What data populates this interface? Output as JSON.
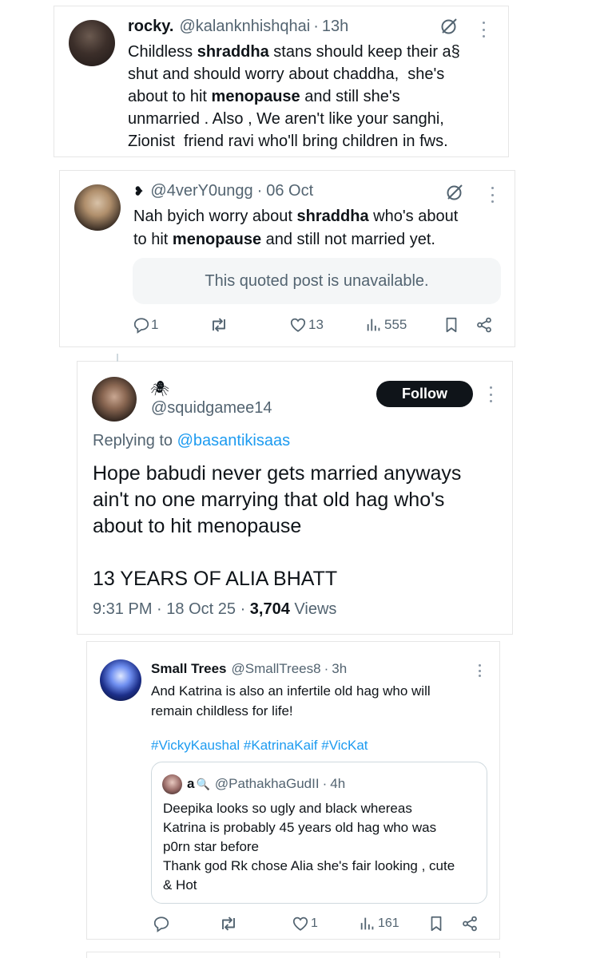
{
  "tweet1": {
    "name": "rocky.",
    "handle": "@kalanknhishqhai",
    "dot": "·",
    "time": "13h",
    "text_lines": [
      [
        {
          "t": "Childless "
        },
        {
          "t": "shraddha",
          "b": true
        },
        {
          "t": " stans should keep their a§"
        }
      ],
      [
        {
          "t": "shut and should worry about chaddha,  she's"
        }
      ],
      [
        {
          "t": "about to hit "
        },
        {
          "t": "menopause",
          "b": true
        },
        {
          "t": " and still she's"
        }
      ],
      [
        {
          "t": "unmarried . Also , We aren't like your sanghi,"
        }
      ],
      [
        {
          "t": "Zionist  friend ravi who'll bring children in fws."
        }
      ]
    ]
  },
  "tweet2": {
    "name_glyph": "❥",
    "handle": "@4verY0ungg",
    "dot": "·",
    "time": "06 Oct",
    "text_lines": [
      [
        {
          "t": "Nah byich worry about "
        },
        {
          "t": "shraddha",
          "b": true
        },
        {
          "t": " who's about"
        }
      ],
      [
        {
          "t": "to hit "
        },
        {
          "t": "menopause",
          "b": true
        },
        {
          "t": " and still not married yet."
        }
      ]
    ],
    "quote_unavailable": "This quoted post is unavailable.",
    "stats": {
      "replies": "1",
      "reposts": "",
      "likes": "13",
      "views": "555"
    }
  },
  "tweet3": {
    "name_glyph": "🕷",
    "handle": "@squidgamee14",
    "follow_label": "Follow",
    "replying_prefix": "Replying to",
    "replying_handle": "@basantikisaas",
    "text_lines": [
      "Hope babudi never gets married anyways",
      "ain't no one marrying that old hag who's",
      "about to hit menopause",
      "",
      "13 YEARS OF ALIA BHATT"
    ],
    "time": "9:31 PM",
    "dot1": "·",
    "date": "18 Oct 25",
    "dot2": "·",
    "views_count": "3,704",
    "views_label": "Views"
  },
  "tweet4": {
    "name": "Small Trees",
    "handle": "@SmallTrees8",
    "dot": "·",
    "time": "3h",
    "text_lines": [
      "And Katrina is also an infertile old hag who will",
      "remain childless for life!"
    ],
    "hashtags": "#VickyKaushal #KatrinaKaif #VicKat",
    "quote": {
      "name": "a",
      "name_glyph": "🔍",
      "handle": "@PathakhaGudII",
      "dot": "·",
      "time": "4h",
      "text_lines": [
        "Deepika looks so ugly and black whereas",
        "Katrina is probably 45 years old hag who was",
        "p0rn star before",
        "Thank god Rk chose Alia she's fair looking , cute",
        "& Hot"
      ]
    },
    "stats": {
      "replies": "",
      "reposts": "",
      "likes": "1",
      "views": "161"
    }
  },
  "colors": {
    "text": "#0f1419",
    "muted": "#536471",
    "link": "#1d9bf0",
    "follow_bg": "#0f1419",
    "quote_bg": "#f4f6f7",
    "border": "#e6e6e6"
  },
  "icons": [
    "grok-icon",
    "more-icon",
    "reply-icon",
    "repost-icon",
    "like-icon",
    "views-icon",
    "bookmark-icon",
    "share-icon"
  ]
}
